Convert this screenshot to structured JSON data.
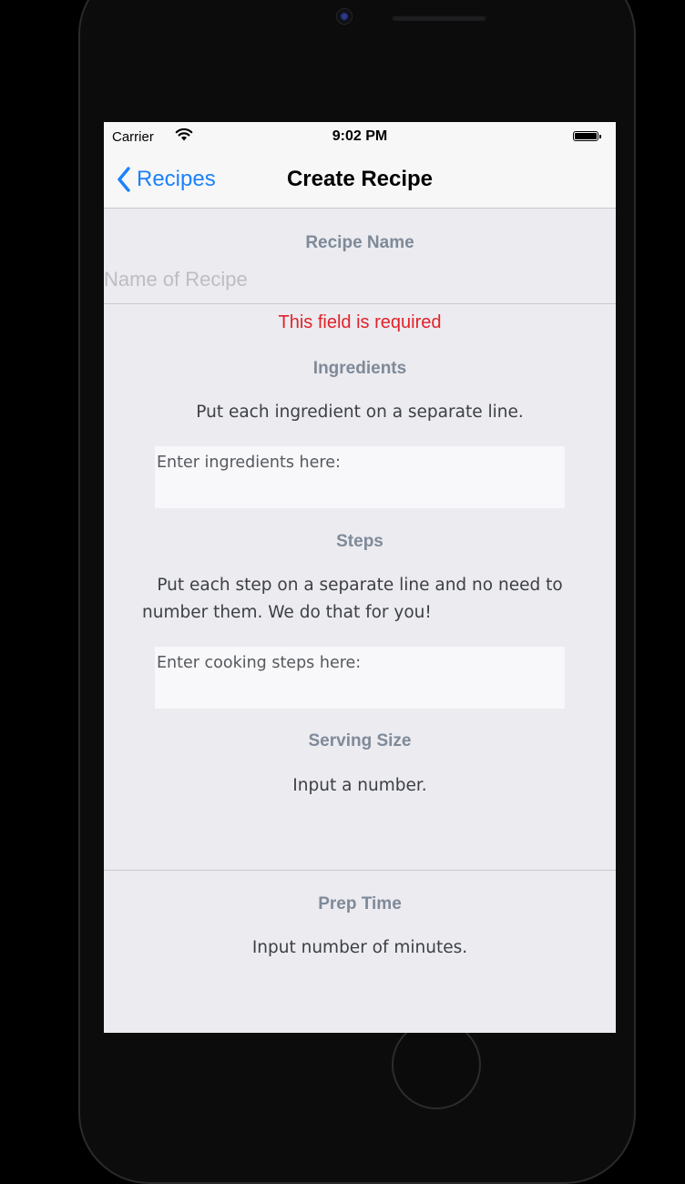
{
  "status_bar": {
    "carrier": "Carrier",
    "time": "9:02 PM"
  },
  "nav": {
    "back_label": "Recipes",
    "title": "Create Recipe"
  },
  "recipe_name": {
    "label": "Recipe Name",
    "placeholder": "Name of Recipe",
    "error": "This field is required"
  },
  "ingredients": {
    "label": "Ingredients",
    "help": "Put each ingredient on a separate line.",
    "placeholder": "Enter ingredients here:"
  },
  "steps": {
    "label": "Steps",
    "help_line1": "Put each step on a separate line and no need to",
    "help_line2": "number them. We do that for you!",
    "placeholder": "Enter cooking steps here:"
  },
  "serving_size": {
    "label": "Serving Size",
    "help": "Input a number."
  },
  "prep_time": {
    "label": "Prep Time",
    "help": "Input number of minutes."
  },
  "colors": {
    "accent": "#1a82fb",
    "error": "#e2222a",
    "background": "#ebebf0"
  },
  "icons": [
    "wifi-icon",
    "battery-icon",
    "chevron-left-icon"
  ]
}
